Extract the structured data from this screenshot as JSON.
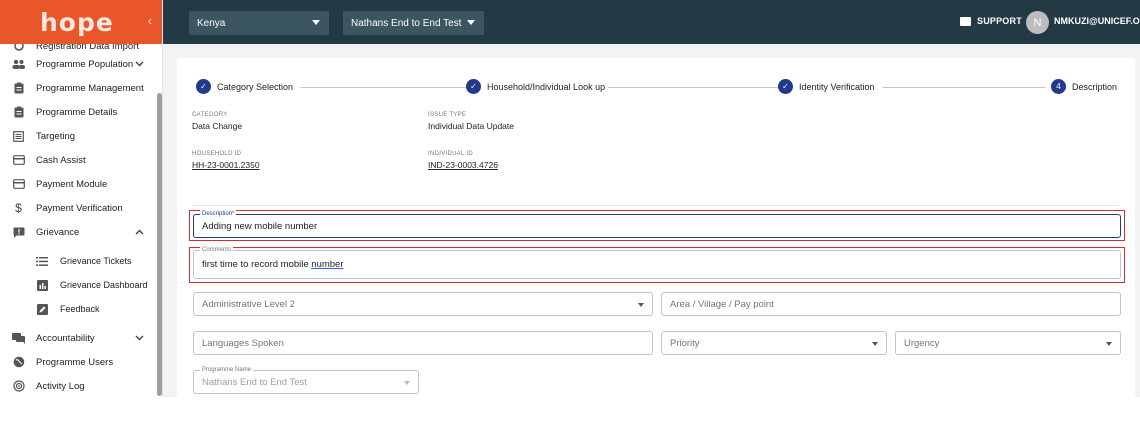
{
  "app": {
    "logo": "hope",
    "collapse_icon": "chevron-left-icon"
  },
  "sidebar": {
    "items": [
      {
        "label": "Registration Data Import",
        "icon": "import-icon"
      },
      {
        "label": "Programme Population",
        "icon": "people-icon",
        "chevron": "⌄"
      },
      {
        "label": "Programme Management",
        "icon": "clipboard-icon"
      },
      {
        "label": "Programme Details",
        "icon": "clipboard-icon"
      },
      {
        "label": "Targeting",
        "icon": "list-box-icon"
      },
      {
        "label": "Cash Assist",
        "icon": "card-icon"
      },
      {
        "label": "Payment Module",
        "icon": "card-icon"
      },
      {
        "label": "Payment Verification",
        "icon": "dollar-icon"
      },
      {
        "label": "Grievance",
        "icon": "feedback-icon",
        "chevron": "⌃"
      },
      {
        "label": "Accountability",
        "icon": "forum-icon",
        "chevron": "⌄"
      },
      {
        "label": "Programme Users",
        "icon": "globe-icon"
      },
      {
        "label": "Activity Log",
        "icon": "activity-icon"
      }
    ],
    "grievance_sub": [
      {
        "label": "Grievance Tickets",
        "icon": "list-icon"
      },
      {
        "label": "Grievance Dashboard",
        "icon": "dashboard-icon"
      },
      {
        "label": "Feedback",
        "icon": "edit-icon"
      }
    ]
  },
  "topbar": {
    "country": "Kenya",
    "programme": "Nathans End to End Test",
    "support": "SUPPORT",
    "avatar_initial": "N",
    "user": "NMKUZI@UNICEF.O"
  },
  "stepper": {
    "steps": [
      {
        "label": "Category Selection",
        "mark": "✓"
      },
      {
        "label": "Household/Individual Look up",
        "mark": "✓"
      },
      {
        "label": "Identity Verification",
        "mark": "✓"
      },
      {
        "label": "Description",
        "mark": "4"
      }
    ]
  },
  "details": {
    "category_key": "CATEGORY",
    "category": "Data Change",
    "issue_type_key": "ISSUE TYPE",
    "issue_type": "Individual Data Update",
    "household_key": "HOUSEHOLD ID",
    "household_id": "HH-23-0001.2350",
    "individual_key": "INDIVIDUAL ID",
    "individual_id": "IND-23-0003.4726"
  },
  "form": {
    "description_label": "Description*",
    "description_value": "Adding new mobile number",
    "comments_label": "Comments",
    "comments_value_a": "first time to record mobile ",
    "comments_value_b": "number",
    "admin_level": "Administrative Level 2",
    "area": "Area / Village / Pay point",
    "languages": "Languages Spoken",
    "priority": "Priority",
    "urgency": "Urgency",
    "programme_label": "Programme Name",
    "programme_value": "Nathans End to End Test"
  },
  "colors": {
    "accent": "#233a8c",
    "topbar": "#233944",
    "logo_bar": "#e8562a",
    "highlight": "#d32f2f"
  }
}
